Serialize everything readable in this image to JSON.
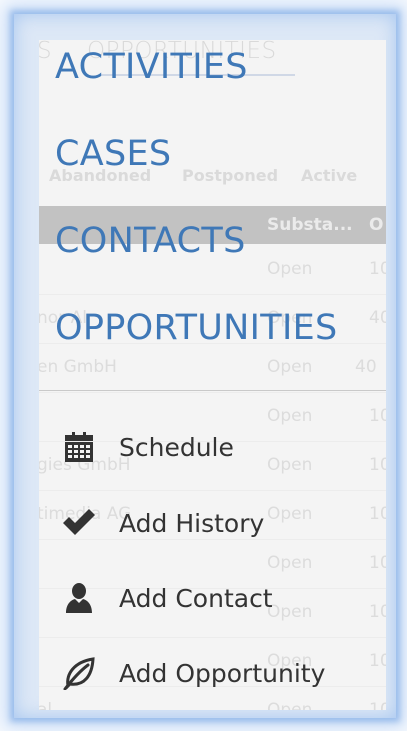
{
  "background_app": {
    "tabs": [
      "S",
      "OPPORTUNITIES"
    ],
    "filters": [
      "Abandoned",
      "Postponed",
      "Active"
    ],
    "columns": [
      "Substa...",
      "O"
    ],
    "rows": [
      {
        "name": "",
        "status": "Open",
        "value": "10"
      },
      {
        "name": "nor Al",
        "status": "Open",
        "value": "40"
      },
      {
        "name": "en GmbH",
        "status": "Open",
        "value": "40"
      },
      {
        "name": "",
        "status": "Open",
        "value": "10"
      },
      {
        "name": "gies GmbH",
        "status": "Open",
        "value": "10"
      },
      {
        "name": "timedia AG",
        "status": "Open",
        "value": "10"
      },
      {
        "name": "",
        "status": "Open",
        "value": "10"
      },
      {
        "name": "",
        "status": "Open",
        "value": "10"
      },
      {
        "name": "",
        "status": "Open",
        "value": "10"
      },
      {
        "name": "al",
        "status": "Open",
        "value": "10"
      }
    ]
  },
  "menu": {
    "nav": [
      {
        "label": "ACTIVITIES"
      },
      {
        "label": "CASES"
      },
      {
        "label": "CONTACTS"
      },
      {
        "label": "OPPORTUNITIES"
      }
    ],
    "actions": [
      {
        "label": "Schedule",
        "icon": "calendar-icon"
      },
      {
        "label": "Add History",
        "icon": "checkmark-icon"
      },
      {
        "label": "Add Contact",
        "icon": "person-icon"
      },
      {
        "label": "Add Opportunity",
        "icon": "leaf-icon"
      }
    ]
  },
  "colors": {
    "nav_text": "#3f78b7",
    "action_text": "#333333",
    "frame_glow": "#5a96dc"
  }
}
